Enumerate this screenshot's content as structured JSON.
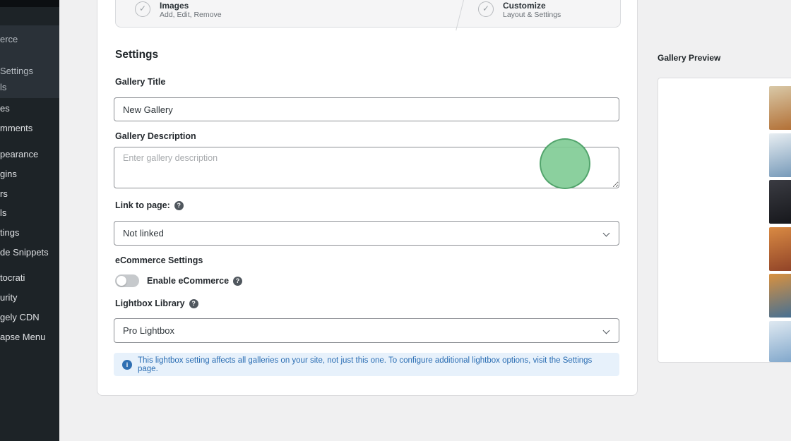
{
  "colors": {
    "page_bg": "#f0f0f1",
    "sidebar_bg": "#1d2327",
    "sidebar_submenu_bg": "#2a3138",
    "card_border": "#dcdcde",
    "accent_blue": "#2271b1",
    "notice_bg": "#e7f1fb",
    "notice_text": "#2a6db3",
    "click_highlight_green": "#7ecb94"
  },
  "icons": {
    "check_glyph": "✓",
    "help_glyph": "?",
    "info_glyph": "i"
  },
  "sidebar": {
    "items": [
      {
        "label": "erce"
      },
      {
        "label": "Settings"
      },
      {
        "label": "ls"
      },
      {
        "label": "es"
      },
      {
        "label": "mments"
      },
      {
        "label": "pearance"
      },
      {
        "label": "gins"
      },
      {
        "label": "rs"
      },
      {
        "label": "ls"
      },
      {
        "label": "tings"
      },
      {
        "label": "de Snippets"
      },
      {
        "label": "tocrati"
      },
      {
        "label": "urity"
      },
      {
        "label": "gely CDN"
      },
      {
        "label": "apse Menu"
      }
    ]
  },
  "stepper": {
    "steps": [
      {
        "title": "Images",
        "subtitle": "Add, Edit, Remove"
      },
      {
        "title": "Customize",
        "subtitle": "Layout & Settings"
      }
    ]
  },
  "settings": {
    "heading": "Settings",
    "gallery_title": {
      "label": "Gallery Title",
      "value": "New Gallery"
    },
    "gallery_description": {
      "label": "Gallery Description",
      "placeholder": "Enter gallery description"
    },
    "link_to_page": {
      "label": "Link to page:",
      "value": "Not linked"
    },
    "ecommerce": {
      "section_label": "eCommerce Settings",
      "toggle_label": "Enable eCommerce",
      "enabled": false
    },
    "lightbox": {
      "label": "Lightbox Library",
      "value": "Pro Lightbox"
    },
    "notice": "This lightbox setting affects all galleries on your site, not just this one. To configure additional lightbox options, visit the Settings page."
  },
  "preview": {
    "heading": "Gallery Preview",
    "thumbnails": [
      {
        "name": "sunset-field-photo",
        "c1": "#d9c9a8",
        "c2": "#b06a2e"
      },
      {
        "name": "blue-sky-clouds-photo",
        "c1": "#e8eef2",
        "c2": "#6f94b5"
      },
      {
        "name": "dark-night-photo",
        "c1": "#3a3b42",
        "c2": "#141519"
      },
      {
        "name": "orange-detail-photo",
        "c1": "#d98a43",
        "c2": "#8c3f26"
      },
      {
        "name": "mountain-sunset-photo",
        "c1": "#d9913f",
        "c2": "#3c6e99"
      },
      {
        "name": "sky-cloud-photo",
        "c1": "#dfe9f1",
        "c2": "#7ba3c9"
      }
    ]
  }
}
